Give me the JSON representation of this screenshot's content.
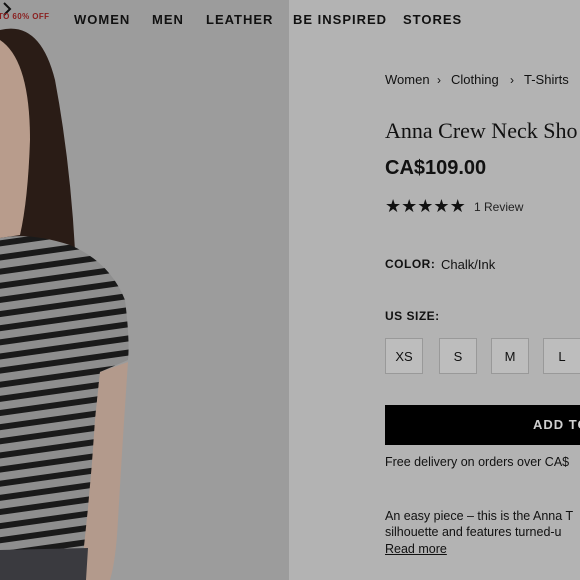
{
  "nav": {
    "promo": "TO 60% OFF",
    "items": [
      "WOMEN",
      "MEN",
      "LEATHER",
      "BE INSPIRED",
      "STORES"
    ]
  },
  "breadcrumb": [
    "Women",
    "Clothing",
    "T-Shirts"
  ],
  "product": {
    "title": "Anna Crew Neck Sho",
    "price": "CA$109.00",
    "rating": 5,
    "reviews": "1 Review",
    "color_label": "COLOR:",
    "color_value": "Chalk/Ink",
    "size_label": "US SIZE:",
    "sizes": [
      "XS",
      "S",
      "M",
      "L"
    ],
    "add_label": "ADD TO",
    "delivery": "Free delivery on orders over CA$",
    "description": [
      "An easy piece – this is the Anna T",
      "silhouette and features turned-u"
    ],
    "read_more": "Read more"
  },
  "icons": {
    "star": "star-icon",
    "next": "chevron-right-icon",
    "breadcrumb_sep": "chevron-right-icon"
  },
  "colors": {
    "promo": "#8a1f1f",
    "button": "#000000"
  }
}
